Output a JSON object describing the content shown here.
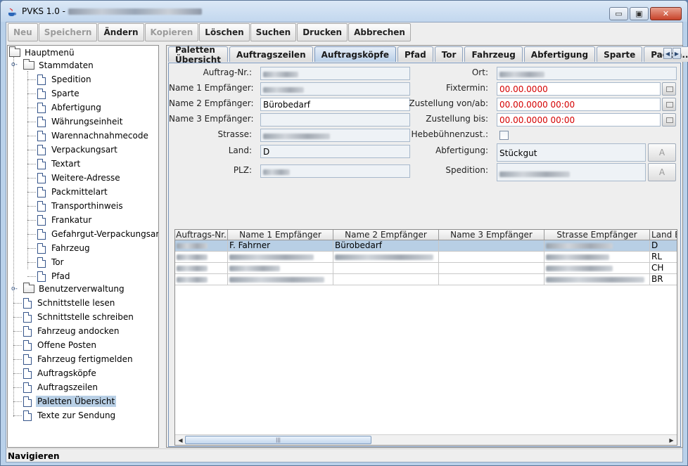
{
  "window": {
    "title": "PVKS 1.0 -",
    "minimize_label": "▭",
    "maximize_label": "▣",
    "close_label": "✕"
  },
  "toolbar": {
    "buttons": [
      {
        "label": "Neu",
        "enabled": false
      },
      {
        "label": "Speichern",
        "enabled": false
      },
      {
        "label": "Ändern",
        "enabled": true
      },
      {
        "label": "Kopieren",
        "enabled": false
      },
      {
        "label": "Löschen",
        "enabled": true
      },
      {
        "label": "Suchen",
        "enabled": true
      },
      {
        "label": "Drucken",
        "enabled": true
      },
      {
        "label": "Abbrechen",
        "enabled": true
      }
    ]
  },
  "tree": {
    "root": "Hauptmenü",
    "stammdaten": "Stammdaten",
    "stammdaten_items": [
      "Spedition",
      "Sparte",
      "Abfertigung",
      "Währungseinheit",
      "Warennachnahmecode",
      "Verpackungsart",
      "Textart",
      "Weitere-Adresse",
      "Packmittelart",
      "Transporthinweis",
      "Frankatur",
      "Gefahrgut-Verpackungsart",
      "Fahrzeug",
      "Tor",
      "Pfad"
    ],
    "benutzerverwaltung": "Benutzerverwaltung",
    "top_items": [
      "Schnittstelle lesen",
      "Schnittstelle schreiben",
      "Fahrzeug andocken",
      "Offene Posten",
      "Fahrzeug fertigmelden",
      "Auftragsköpfe",
      "Auftragszeilen",
      "Paletten Übersicht",
      "Texte zur Sendung"
    ],
    "selected": "Paletten Übersicht"
  },
  "tabs": {
    "items": [
      "Paletten Übersicht",
      "Auftragszeilen",
      "Auftragsköpfe",
      "Pfad",
      "Tor",
      "Fahrzeug",
      "Abfertigung",
      "Sparte",
      "Packm..."
    ],
    "active": "Auftragsköpfe"
  },
  "form": {
    "auftrag_nr_label": "Auftrag-Nr.:",
    "name1_label": "Name 1 Empfänger:",
    "name2_label": "Name 2 Empfänger:",
    "name2_value": "Bürobedarf",
    "name3_label": "Name 3 Empfänger:",
    "strasse_label": "Strasse:",
    "land_label": "Land:",
    "land_value": "D",
    "plz_label": "PLZ:",
    "ort_label": "Ort:",
    "fixtermin_label": "Fixtermin:",
    "fixtermin_value": "00.00.0000",
    "zustellung_von_label": "Zustellung von/ab:",
    "zustellung_von_value": "00.00.0000 00:00",
    "zustellung_bis_label": "Zustellung bis:",
    "zustellung_bis_value": "00.00.0000 00:00",
    "hebebuehne_label": "Hebebühnenzust.:",
    "abfertigung_label": "Abfertigung:",
    "abfertigung_value": "Stückgut",
    "spedition_label": "Spedition:",
    "a_button_label": "A",
    "red_color": "#d40000"
  },
  "table": {
    "columns": [
      "Auftrags-Nr.",
      "Name 1 Empfänger",
      "Name 2 Empfänger",
      "Name 3 Empfänger",
      "Strasse Empfänger",
      "Land E"
    ],
    "rows": [
      {
        "name1": "F. Fahrner",
        "name2": "Bürobedarf",
        "land": "D"
      },
      {
        "name1": "",
        "name2": "",
        "land": "RL"
      },
      {
        "name1": "",
        "name2": "",
        "land": "CH"
      },
      {
        "name1": "",
        "name2": "",
        "land": "BR"
      }
    ],
    "scroll_thumb_label": "|||"
  },
  "status": {
    "text": "Navigieren"
  }
}
